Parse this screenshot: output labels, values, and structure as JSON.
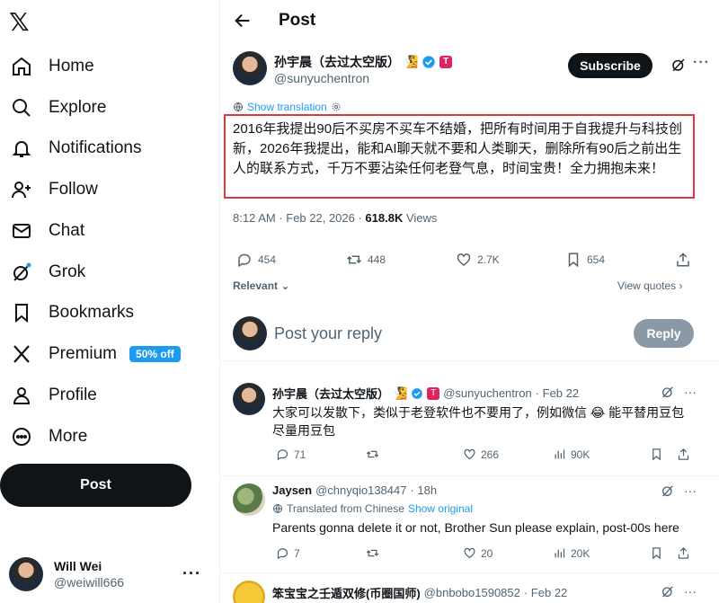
{
  "sidebar": {
    "logo": "𝕏",
    "items": [
      {
        "label": "Home",
        "icon": "home-icon"
      },
      {
        "label": "Explore",
        "icon": "search-icon"
      },
      {
        "label": "Notifications",
        "icon": "bell-icon"
      },
      {
        "label": "Follow",
        "icon": "follow-icon"
      },
      {
        "label": "Chat",
        "icon": "mail-icon"
      },
      {
        "label": "Grok",
        "icon": "grok-icon"
      },
      {
        "label": "Bookmarks",
        "icon": "bookmark-icon"
      },
      {
        "label": "Premium",
        "icon": "x-logo-icon",
        "badge": "50% off"
      },
      {
        "label": "Profile",
        "icon": "person-icon"
      },
      {
        "label": "More",
        "icon": "more-circle-icon"
      }
    ],
    "post_button": "Post",
    "account": {
      "name": "Will Wei",
      "handle": "@weiwill666",
      "more": "···"
    }
  },
  "header": {
    "title": "Post"
  },
  "tweet": {
    "author_name": "孙宇晨（去过太空版）",
    "author_handle": "@sunyuchentron",
    "subscribe_label": "Subscribe",
    "show_translation": "Show translation",
    "text": "2016年我提出90后不买房不买车不结婚，把所有时间用于自我提升与科技创新，2026年我提出，能和AI聊天就不要和人类聊天，删除所有90后之前出生人的联系方式，千万不要沾染任何老登气息，时间宝贵！全力拥抱未来！",
    "timestamp": "8:12 AM · Feb 22, 2026 · ",
    "views_count": "618.8K",
    "views_label": " Views",
    "stats": {
      "replies": "454",
      "reposts": "448",
      "likes": "2.7K",
      "bookmarks": "654"
    },
    "sort_label": "Relevant",
    "view_quotes": "View quotes"
  },
  "reply_box": {
    "placeholder": "Post your reply",
    "button": "Reply"
  },
  "replies": [
    {
      "name": "孙宇晨（去过太空版）",
      "handle": "@sunyuchentron",
      "time": "· Feb 22",
      "text": "大家可以发散下，类似于老登软件也不要用了，例如微信 😂 能平替用豆包尽量用豆包",
      "stats": {
        "replies": "71",
        "reposts": "",
        "likes": "266",
        "views": "90K"
      }
    },
    {
      "name": "Jaysen",
      "handle": "@chnyqio138447",
      "time": "· 18h",
      "translated_from": "Translated from Chinese",
      "show_original": "Show original",
      "text": "Parents gonna delete it or not, Brother Sun please explain, post-00s here",
      "stats": {
        "replies": "7",
        "reposts": "",
        "likes": "20",
        "views": "20K"
      }
    },
    {
      "name": "笨宝宝之壬遁双修(币圈国师)",
      "handle": "@bnbobo1590852",
      "time": "· Feb 22"
    }
  ],
  "colors": {
    "accent": "#1d9bf0",
    "highlight_border": "#e0383e",
    "text": "#0f1419",
    "muted": "#536471"
  }
}
